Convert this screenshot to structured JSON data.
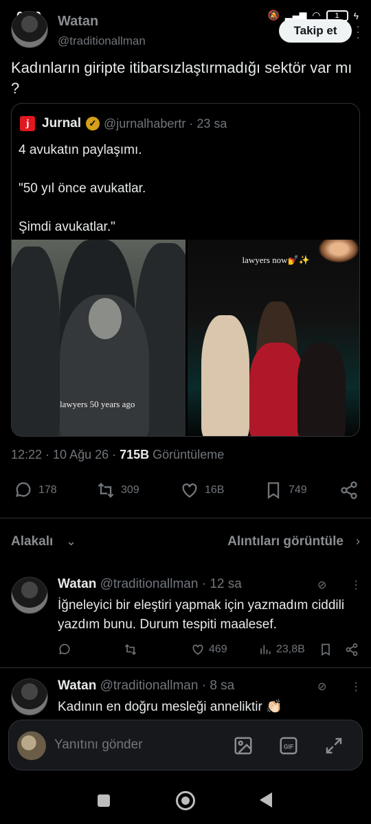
{
  "status": {
    "time": "0:50",
    "battery": "1"
  },
  "header": {
    "name": "Watan",
    "handle": "@traditionallman",
    "follow_label": "Takip et"
  },
  "tweet": {
    "text": "Kadınların giripte itibarsızlaştırmadığı sektör var mı ?",
    "meta_time": "12:22 · 10 Ağu 26 · ",
    "views_count": "715B",
    "views_label": " Görüntüleme",
    "replies": "178",
    "retweets": "309",
    "likes": "16B",
    "bookmarks": "749"
  },
  "quote": {
    "logo_letter": "j",
    "name": "Jurnal",
    "handle_time": "@jurnalhabertr · 23 sa",
    "body": "4 avukatın paylaşımı.\n\n\"50 yıl önce avukatlar.\n\nŞimdi avukatlar.\"",
    "caption_left": "lawyers 50 years ago",
    "caption_right": "lawyers now💅✨"
  },
  "sort": {
    "label": "Alakalı",
    "quotes_link": "Alıntıları görüntüle"
  },
  "replies": [
    {
      "name": "Watan",
      "handle_time": "@traditionallman · 12 sa",
      "text": "İğneleyici bir eleştiri yapmak için yazmadım ciddili yazdım bunu. Durum tespiti maalesef.",
      "likes": "469",
      "views": "23,8B"
    },
    {
      "name": "Watan",
      "handle_time": "@traditionallman · 8 sa",
      "text": "Kadının en doğru mesleği anneliktir 👏🏻"
    }
  ],
  "composer": {
    "placeholder": "Yanıtını gönder",
    "gif_label": "GIF"
  },
  "colors": {
    "background": "#000000",
    "text": "#e7e9ea",
    "secondary": "#71767b",
    "follow_bg": "#eff3f4",
    "jurnal_red": "#e0181f"
  }
}
